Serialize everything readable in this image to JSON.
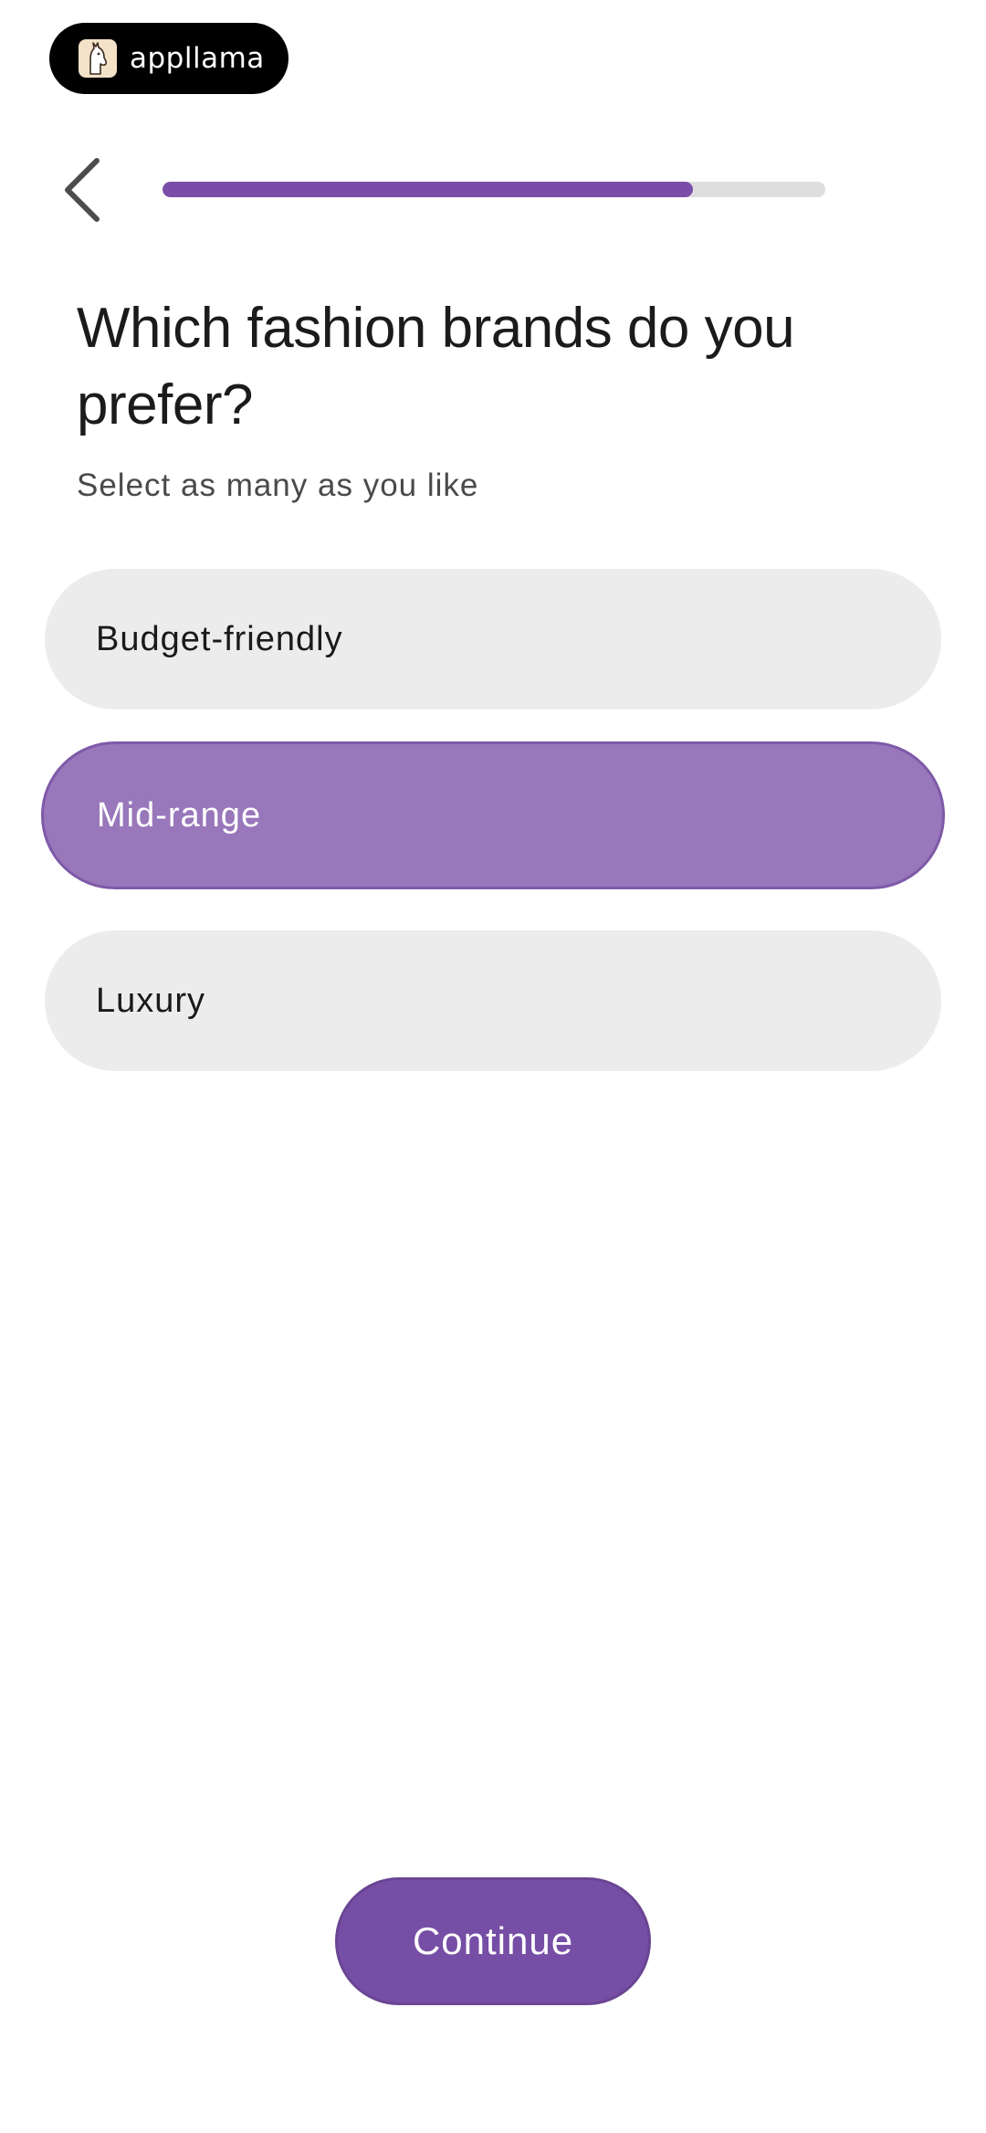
{
  "brand": {
    "name": "appllama",
    "logo_icon": "llama-icon"
  },
  "navigation": {
    "back_icon": "chevron-left-icon"
  },
  "progress": {
    "fraction": 0.8,
    "fill_color": "#7a4ea8",
    "track_color": "#dedede"
  },
  "question": {
    "title": "Which fashion brands do you prefer?",
    "subtitle": "Select as many as you like"
  },
  "options": [
    {
      "label": "Budget-friendly",
      "selected": false
    },
    {
      "label": "Mid-range",
      "selected": true
    },
    {
      "label": "Luxury",
      "selected": false
    }
  ],
  "continue_button": {
    "label": "Continue"
  },
  "colors": {
    "accent": "#764ea6",
    "selected_option": "#9877bb",
    "unselected_option": "#ececec"
  }
}
